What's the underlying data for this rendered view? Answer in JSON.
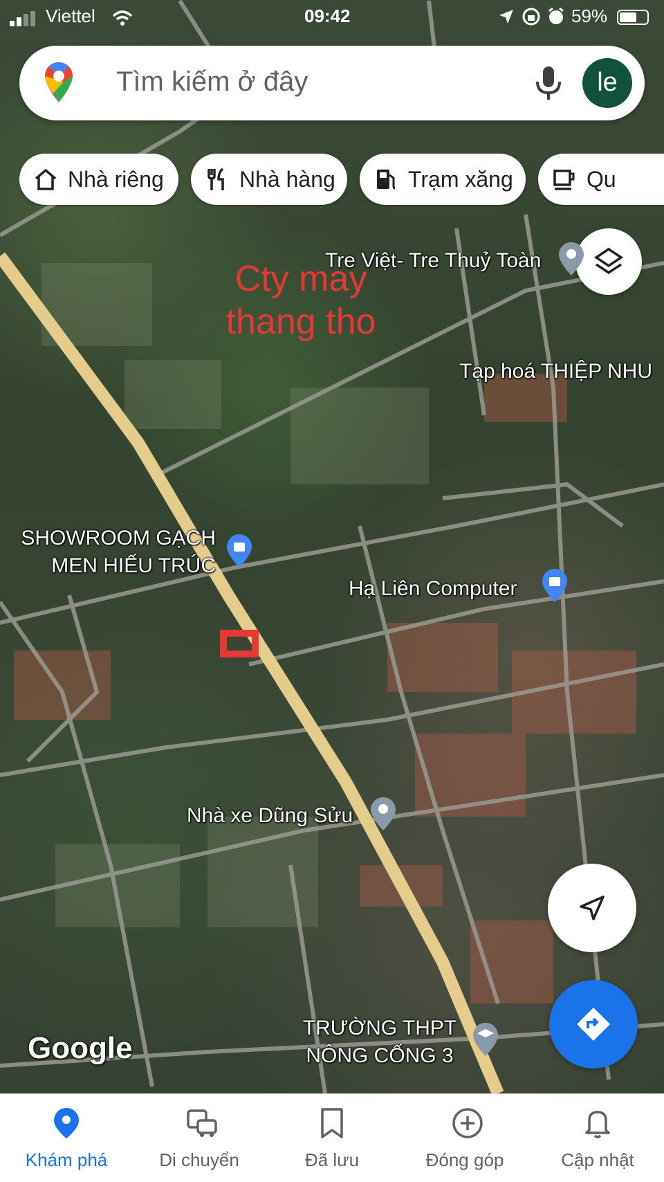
{
  "status_bar": {
    "carrier": "Viettel",
    "time": "09:42",
    "battery": "59%"
  },
  "search": {
    "placeholder": "Tìm kiếm ở đây",
    "avatar_text": "le"
  },
  "chips": [
    {
      "label": "Nhà riêng",
      "icon": "home-icon"
    },
    {
      "label": "Nhà hàng",
      "icon": "restaurant-icon"
    },
    {
      "label": "Trạm xăng",
      "icon": "gas-station-icon"
    },
    {
      "label": "Qu",
      "icon": "coffee-icon"
    }
  ],
  "map": {
    "annotation": "Cty may thang tho",
    "places": [
      {
        "name": "Tre Việt- Tre Thuỷ Toàn"
      },
      {
        "name": "Tạp hoá THIỆP NHU"
      },
      {
        "name": "SHOWROOM GẠCH MEN HIẾU TRÚC"
      },
      {
        "name": "Hạ Liên Computer"
      },
      {
        "name": "Nhà xe Dũng Sửu"
      },
      {
        "name": "TRƯỜNG THPT NÔNG CỐNG 3"
      }
    ],
    "attribution": "Google"
  },
  "colors": {
    "accent": "#1a73e8",
    "annotation": "#e53935",
    "avatar_bg": "#12523d"
  },
  "bottom_nav": [
    {
      "label": "Khám phá",
      "icon": "explore-pin-icon",
      "active": true
    },
    {
      "label": "Di chuyển",
      "icon": "commute-icon",
      "active": false
    },
    {
      "label": "Đã lưu",
      "icon": "bookmark-icon",
      "active": false
    },
    {
      "label": "Đóng góp",
      "icon": "add-circle-icon",
      "active": false
    },
    {
      "label": "Cập nhật",
      "icon": "bell-icon",
      "active": false
    }
  ]
}
